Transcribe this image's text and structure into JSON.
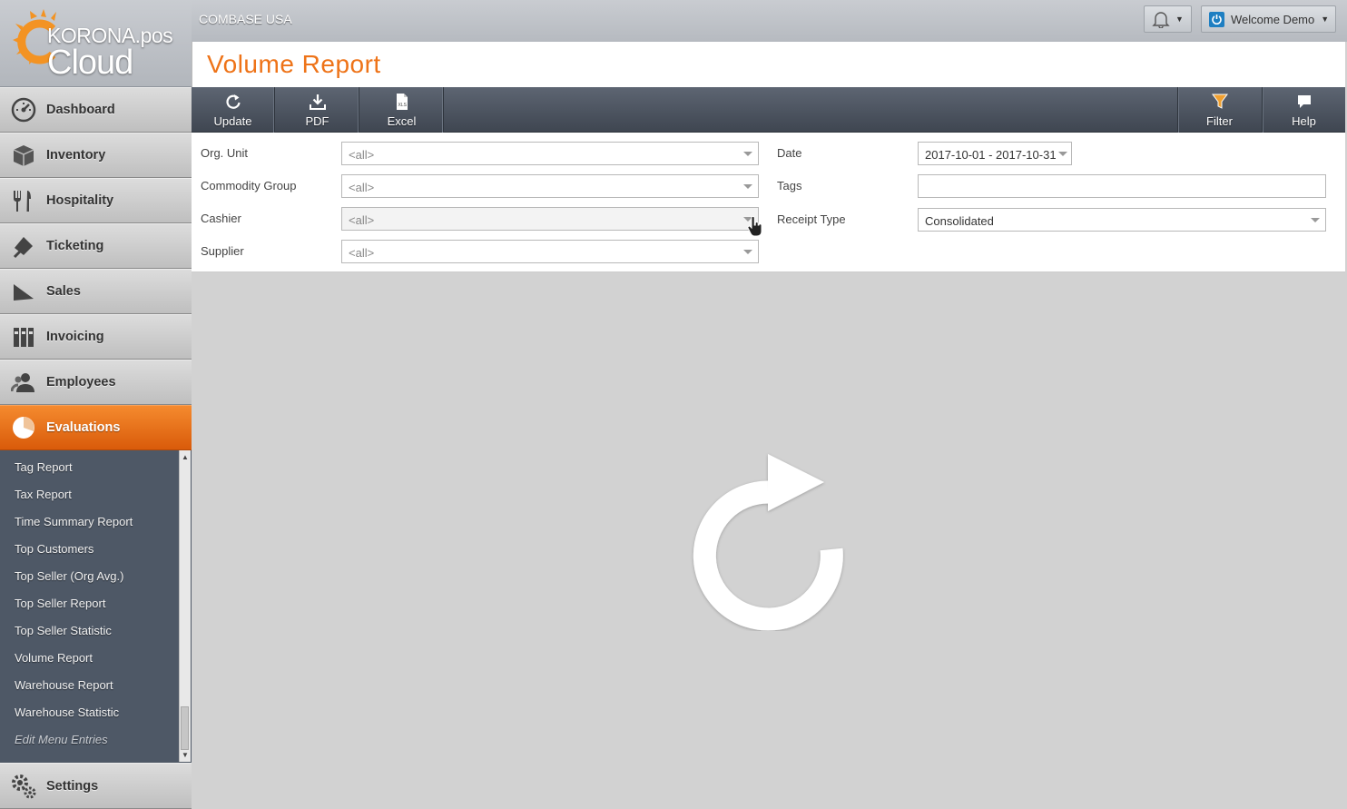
{
  "app": {
    "logo_text": "KORONA.pos",
    "logo_subtext": "Cloud",
    "company": "COMBASE USA"
  },
  "header": {
    "user_label": "Welcome Demo"
  },
  "nav": {
    "items": [
      {
        "label": "Dashboard",
        "icon": "speedometer-icon"
      },
      {
        "label": "Inventory",
        "icon": "box-icon"
      },
      {
        "label": "Hospitality",
        "icon": "cutlery-icon"
      },
      {
        "label": "Ticketing",
        "icon": "ticket-icon"
      },
      {
        "label": "Sales",
        "icon": "sales-icon"
      },
      {
        "label": "Invoicing",
        "icon": "binders-icon"
      },
      {
        "label": "Employees",
        "icon": "people-icon"
      },
      {
        "label": "Evaluations",
        "icon": "pie-chart-icon"
      },
      {
        "label": "Settings",
        "icon": "gears-icon"
      }
    ],
    "active": "Evaluations",
    "submenu": [
      "Tag Report",
      "Tax Report",
      "Time Summary Report",
      "Top Customers",
      "Top Seller (Org Avg.)",
      "Top Seller Report",
      "Top Seller Statistic",
      "Volume Report",
      "Warehouse Report",
      "Warehouse Statistic"
    ],
    "edit_entry": "Edit Menu Entries"
  },
  "page": {
    "title": "Volume Report"
  },
  "toolbar": {
    "update": "Update",
    "pdf": "PDF",
    "excel": "Excel",
    "filter": "Filter",
    "help": "Help"
  },
  "filters": {
    "org_unit": {
      "label": "Org. Unit",
      "value": "<all>"
    },
    "commodity_group": {
      "label": "Commodity Group",
      "value": "<all>"
    },
    "cashier": {
      "label": "Cashier",
      "value": "<all>"
    },
    "supplier": {
      "label": "Supplier",
      "value": "<all>"
    },
    "date": {
      "label": "Date",
      "value": "2017-10-01 - 2017-10-31"
    },
    "tags": {
      "label": "Tags",
      "value": ""
    },
    "receipt_type": {
      "label": "Receipt Type",
      "value": "Consolidated"
    }
  },
  "colors": {
    "accent": "#ee7318",
    "sidebar_bg": "#4c5663",
    "toolbar_bg": "#4a515c"
  }
}
